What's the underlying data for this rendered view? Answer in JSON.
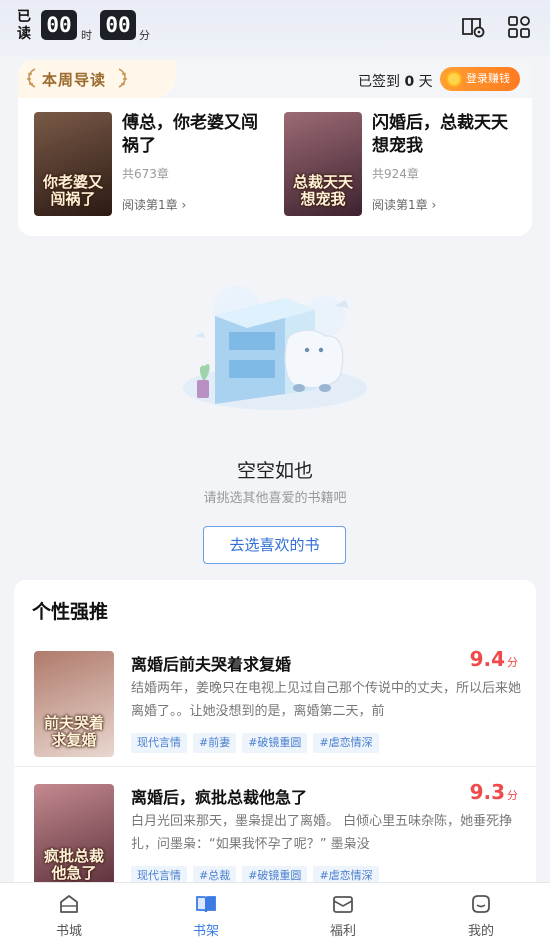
{
  "topbar": {
    "read_label_1": "已",
    "read_label_2": "读",
    "hours": "00",
    "hours_unit": "时",
    "minutes": "00",
    "minutes_unit": "分",
    "icons": [
      "book-settings-icon",
      "grid-apps-icon"
    ]
  },
  "guide": {
    "title": "本周导读",
    "signin_prefix": "已签到",
    "signin_days": "0",
    "signin_suffix": "天",
    "earn_button": "登录赚钱",
    "books": [
      {
        "title": "傅总，你老婆又闯祸了",
        "count": "共673章",
        "read": "阅读第1章 ›",
        "cover_text": "你老婆又闯祸了",
        "cover_colors": [
          "#2b1a14",
          "#7a5a48"
        ]
      },
      {
        "title": "闪婚后，总裁天天想宠我",
        "count": "共924章",
        "read": "阅读第1章 ›",
        "cover_text": "总裁天天想宠我",
        "cover_colors": [
          "#3d2230",
          "#9c6b74"
        ]
      }
    ]
  },
  "empty": {
    "title": "空空如也",
    "subtitle": "请挑选其他喜爱的书籍吧",
    "button": "去选喜欢的书"
  },
  "recommend": {
    "title": "个性强推",
    "items": [
      {
        "name": "离婚后前夫哭着求复婚",
        "score": "9.4",
        "score_unit": "分",
        "desc": "结婚两年，姜晚只在电视上见过自己那个传说中的丈夫，所以后来她离婚了。。让她没想到的是，离婚第二天，前",
        "tags": [
          "现代言情",
          "#前妻",
          "#破镜重圆",
          "#虐恋情深"
        ],
        "cover_text": "前夫哭着求复婚",
        "cover_colors": [
          "#e9d7cf",
          "#b07a6c"
        ]
      },
      {
        "name": "离婚后，疯批总裁他急了",
        "score": "9.3",
        "score_unit": "分",
        "desc": "白月光回来那天，墨枭提出了离婚。 白倾心里五味杂陈，她垂死挣扎，问墨枭：“如果我怀孕了呢？” 墨枭没",
        "tags": [
          "现代言情",
          "#总裁",
          "#破镜重圆",
          "#虐恋情深"
        ],
        "cover_text": "疯批总裁他急了",
        "cover_colors": [
          "#5a2e3a",
          "#c48a8f"
        ]
      }
    ]
  },
  "nav": {
    "items": [
      {
        "label": "书城",
        "icon": "bookstore-icon"
      },
      {
        "label": "书架",
        "icon": "bookshelf-icon"
      },
      {
        "label": "福利",
        "icon": "welfare-icon"
      },
      {
        "label": "我的",
        "icon": "profile-icon"
      }
    ],
    "active_index": 1,
    "active_color": "#3b7be3"
  }
}
